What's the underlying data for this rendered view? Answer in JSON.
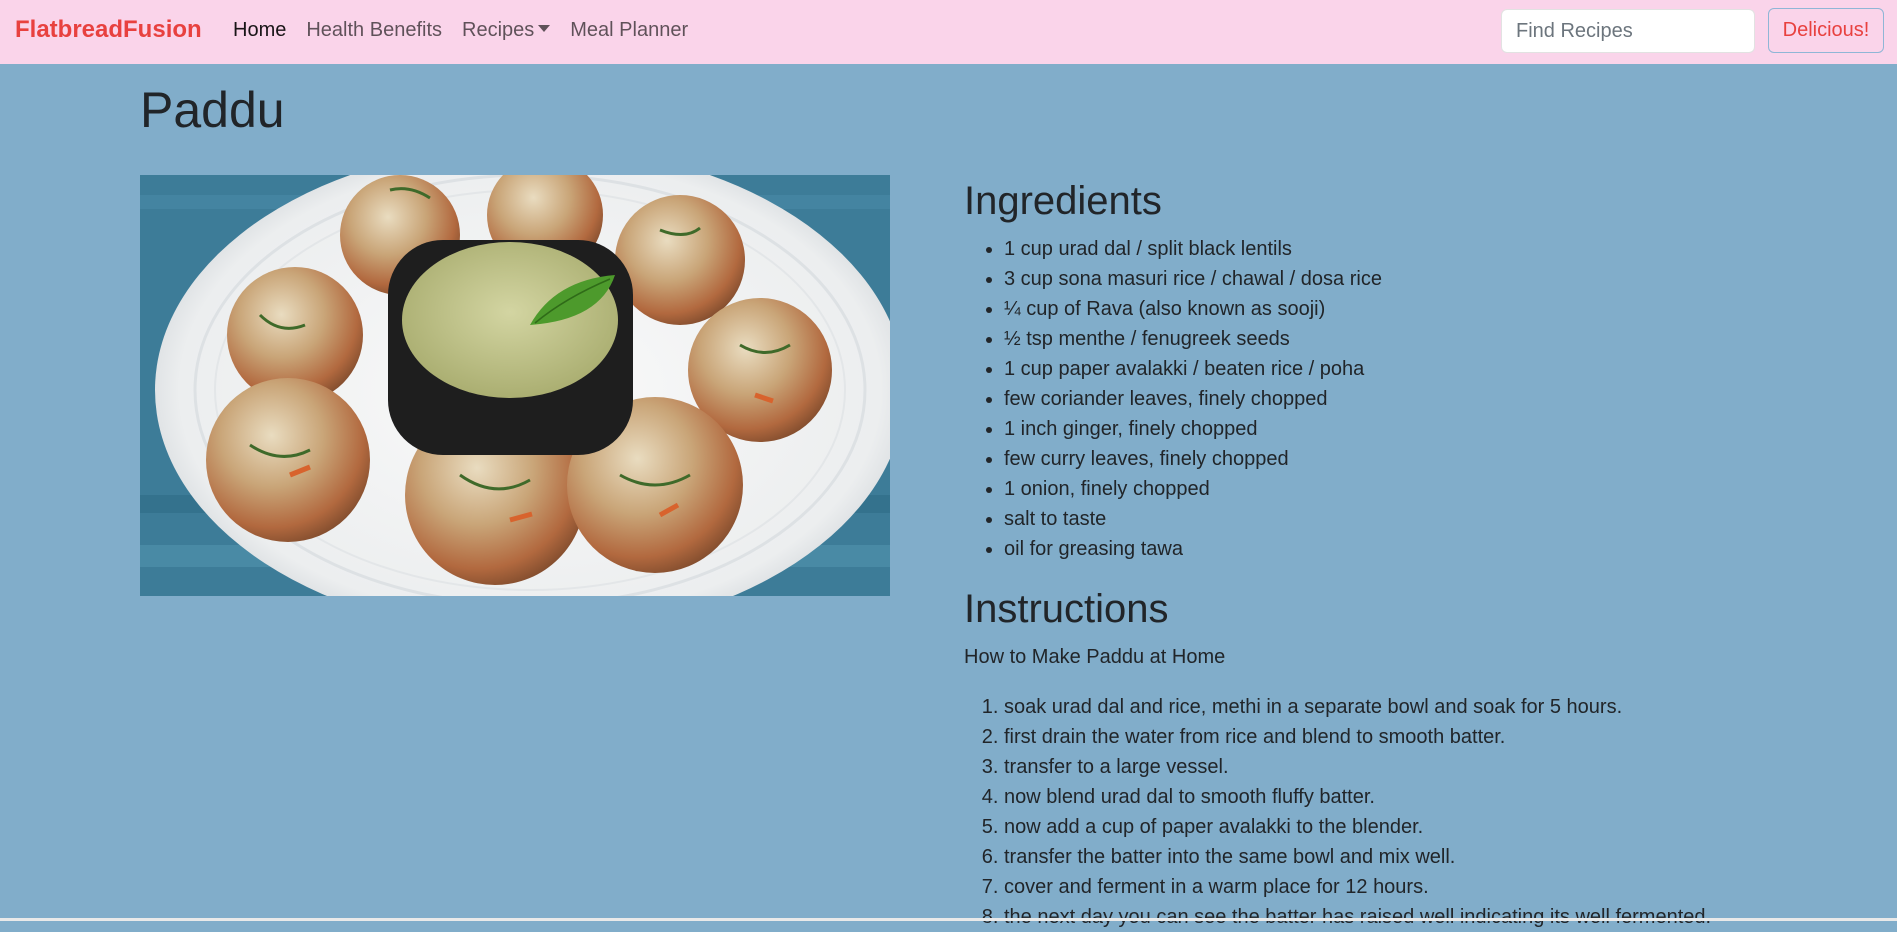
{
  "nav": {
    "brand": "FlatbreadFusion",
    "links": [
      "Home",
      "Health Benefits",
      "Recipes",
      "Meal Planner"
    ],
    "search_placeholder": "Find Recipes",
    "search_button": "Delicious!"
  },
  "colors": {
    "navbar_bg": "#fad4ea",
    "brand": "#e8413f",
    "page_bg": "#81adca"
  },
  "recipe": {
    "title": "Paddu",
    "ingredients_heading": "Ingredients",
    "ingredients": [
      "1 cup urad dal / split black lentils",
      "3 cup sona masuri rice / chawal / dosa rice",
      "¼ cup of Rava (also known as sooji)",
      "½ tsp menthe / fenugreek seeds",
      "1 cup paper avalakki / beaten rice / poha",
      "few coriander leaves, finely chopped",
      "1 inch ginger, finely chopped",
      "few curry leaves, finely chopped",
      "1 onion, finely chopped",
      "salt to taste",
      "oil for greasing tawa"
    ],
    "instructions_heading": "Instructions",
    "instructions_intro": "How to Make Paddu at Home",
    "steps": [
      "soak urad dal and rice, methi in a separate bowl and soak for 5 hours.",
      "first drain the water from rice and blend to smooth batter.",
      "transfer to a large vessel.",
      "now blend urad dal to smooth fluffy batter.",
      "now add a cup of paper avalakki to the blender.",
      "transfer the batter into the same bowl and mix well.",
      "cover and ferment in a warm place for 12 hours.",
      "the next day you can see the batter has raised well indicating its well fermented."
    ]
  }
}
